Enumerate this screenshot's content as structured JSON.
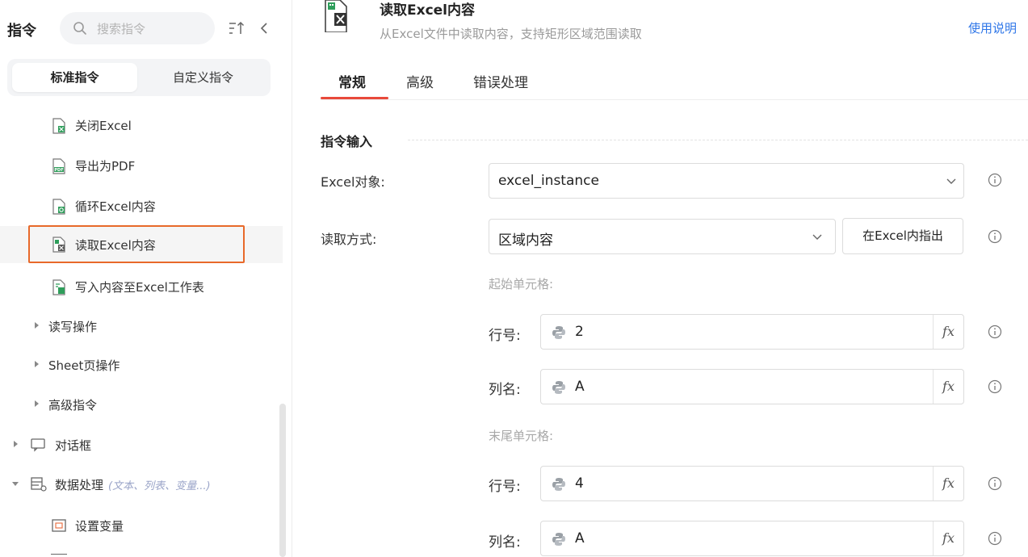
{
  "sidebar": {
    "title": "指令",
    "search_placeholder": "搜索指令",
    "segments": {
      "standard": "标准指令",
      "custom": "自定义指令"
    },
    "items": [
      {
        "label": "关闭Excel",
        "icon": "excel-close-icon"
      },
      {
        "label": "导出为PDF",
        "icon": "pdf-export-icon"
      },
      {
        "label": "循环Excel内容",
        "icon": "excel-loop-icon"
      },
      {
        "label": "读取Excel内容",
        "icon": "excel-read-icon",
        "selected": true
      },
      {
        "label": "写入内容至Excel工作表",
        "icon": "excel-write-icon"
      }
    ],
    "groups": [
      {
        "label": "读写操作"
      },
      {
        "label": "Sheet页操作"
      },
      {
        "label": "高级指令"
      }
    ],
    "categories": [
      {
        "label": "对话框",
        "icon": "dialog-icon",
        "expanded": false
      },
      {
        "label": "数据处理",
        "hint": "(文本、列表、变量...)",
        "icon": "data-process-icon",
        "expanded": true
      }
    ],
    "sub_items": [
      {
        "label": "设置变量",
        "icon": "set-variable-icon"
      }
    ]
  },
  "main": {
    "title": "读取Excel内容",
    "description": "从Excel文件中读取内容，支持矩形区域范围读取",
    "help_link": "使用说明",
    "tabs": [
      {
        "label": "常规",
        "active": true
      },
      {
        "label": "高级"
      },
      {
        "label": "错误处理"
      }
    ],
    "section_title": "指令输入",
    "excel_object": {
      "label": "Excel对象:",
      "value": "excel_instance"
    },
    "read_mode": {
      "label": "读取方式:",
      "value": "区域内容",
      "locate_button": "在Excel内指出"
    },
    "start_cell": {
      "heading": "起始单元格:",
      "row": {
        "label": "行号:",
        "value": "2"
      },
      "col": {
        "label": "列名:",
        "value": "A"
      }
    },
    "end_cell": {
      "heading": "末尾单元格:",
      "row": {
        "label": "行号:",
        "value": "4"
      },
      "col": {
        "label": "列名:",
        "value": "A"
      }
    },
    "fx_label": "fx"
  },
  "colors": {
    "accent_tab": "#e8493a",
    "selection_border": "#e8692a",
    "link": "#2e76e8",
    "excel_green": "#2f9e5b"
  }
}
